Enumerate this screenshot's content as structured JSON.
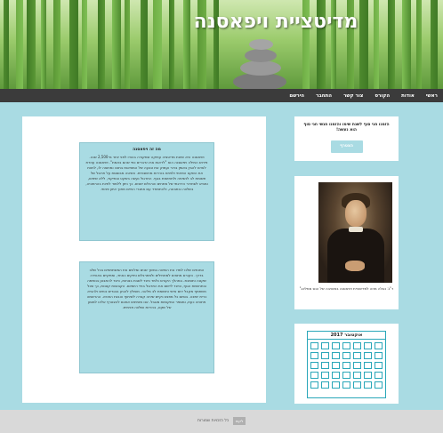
{
  "header": {
    "site_title": "מדיטציית ויפאסנה"
  },
  "nav": {
    "items": [
      "ראשי",
      "אודות",
      "הקורס",
      "צור קשר",
      "התחבר",
      "הירשם"
    ]
  },
  "main": {
    "box1": {
      "title": "מה זה ויפאסנה",
      "text": "ויפאסנה היא שיטת מדיטציה עתיקה שמקורה בהודו לפני יותר מ-2,500 שנה. פירוש המילה ויפאסנה הוא \"לראות את הדברים כפי שהם באמת\". ויפאסנה עוזרת לאדם להבין באופן ברור ועמוק את טבעה של המציאות בתוכו ומחוצה לו, לחוות את השקט הפנימי ולפתח בהירות מחשבתית. השיטה מבוססת על תרגול של תשומת לב לנשימה ולתחושות בגוף. התרגול נעשה בשקט ובמיקוד, ללא שיפוט, ומביא לשחרור הדרגתי של מתחים והרגלים ישנים. כך ניתן ללמוד לחיות בהרמוניה, בשלווה ובתבונה, ולהתמודד עם אתגרי החיים מתוך איזון פנימי."
    },
    "box2": {
      "text": "המנחים שלנו למדו את השיטה במשך שנים ומלווים את המשתתפים בכל שלב בדרך. הקורס מתאים למתחילים ולמתרגלים ותיקים כאחד, ומתקיים באווירה שקטה ותומכת. במהלך הקורס נלמד כיצד לשבת בנוחות, כיצד להתבונן בנשימה ובתחושות הגוף, וכיצד ליישם את התרגול בחיי היומיום. הקבוצות קטנות, כך שכל משתתף מקבל יחס אישי ותשומת לב מלאה. מומלץ להגיע בבגדים נוחים ולהביא כרית ישיבה. בסיום כל מפגש נקיים שיחה קצרה לשיתוף והבנת החוויה. ההרשמה פתוחה כעת, ומספר המקומות מוגבל. אנו מזמינים אתכם להצטרף אלינו למסע של שקט, בהירות ושלווה פנימית."
    }
  },
  "sidebar": {
    "newsletter": {
      "text": "הזמנו חגי סוף לשנת שימו והזמנו חגשי חגי סוף הוא נעשה!",
      "button_label": "הצטרף"
    },
    "portrait": {
      "caption": "ר\"נ: נוגלה מוזה למדיטציית ויפאסנה במוטיבה של הנס ממלינג\""
    },
    "calendar": {
      "month_label": "אוקטובר 2017",
      "cells": 35
    }
  },
  "footer": {
    "text": "כל הזכויות שמורות",
    "badge": "לקוח"
  },
  "colors": {
    "accent": "#a9dbe3",
    "nav_bg": "#3b3b3b",
    "calendar_border": "#2aa7b9"
  }
}
